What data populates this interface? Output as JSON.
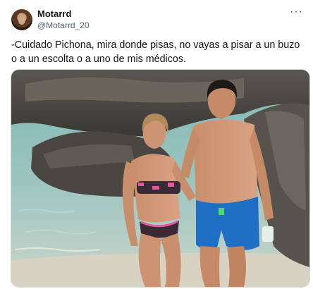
{
  "tweet": {
    "author_name": "Motarrd",
    "author_handle": "@Motarrd_20",
    "more_icon": "more-dots-icon",
    "text": "-Cuidado Pichona, mira donde pisas, no vayas a pisar a un buzo o a un escolta o a uno de mis médicos."
  },
  "colors": {
    "text": "#0f1419",
    "secondary": "#536471",
    "border": "#cfd9de"
  }
}
